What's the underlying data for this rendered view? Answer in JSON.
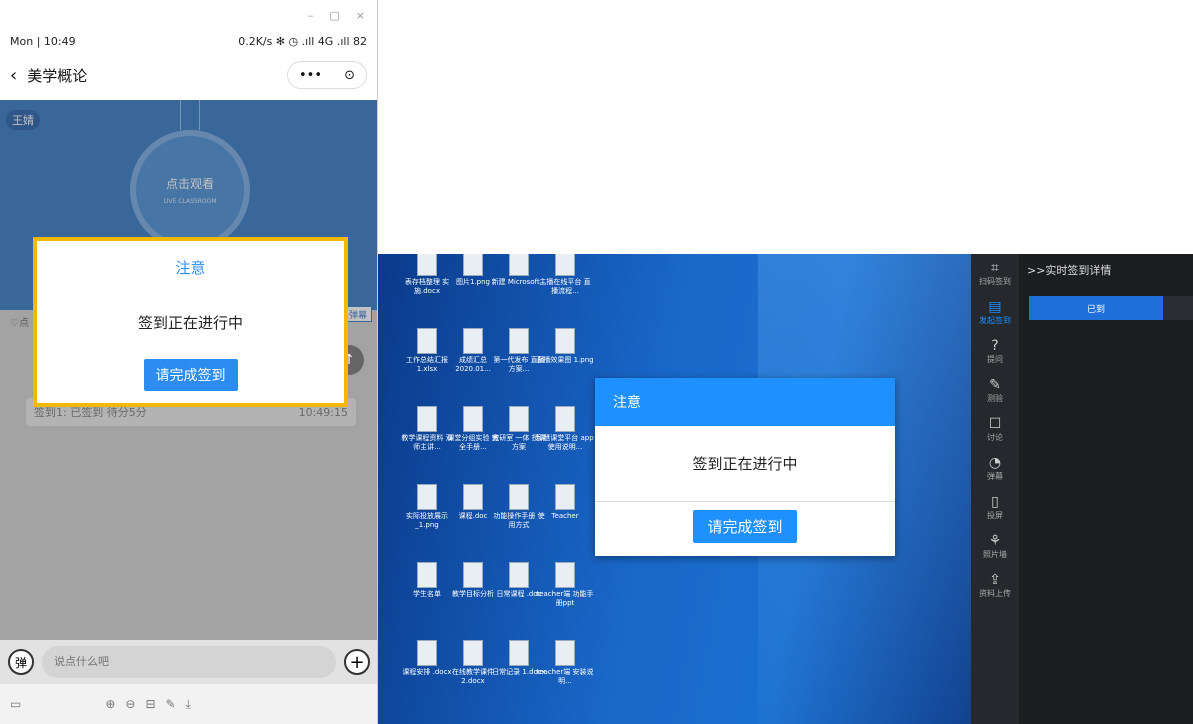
{
  "phone": {
    "window_controls": [
      "–",
      "▢",
      "×"
    ],
    "status_left": "Mon | 10:49",
    "status_right": "0.2K/s ✻ ◷ .ıll 4G .ıll 82",
    "nav_title": "美学概论",
    "capsule_more": "•••",
    "capsule_close": "⊙",
    "teacher": "王婧",
    "live_main": "点击观看",
    "live_sub": "LIVE CLASSROOM",
    "like": "♡点",
    "tag_btn": "弹幕",
    "sign_card_left": "签到1: 已签到 待分5分",
    "sign_card_right": "10:49:15",
    "modal": {
      "title": "注意",
      "body": "签到正在进行中",
      "button": "请完成签到"
    },
    "input_placeholder": "说点什么吧",
    "dan_label": "弹",
    "toolbar": [
      "⊕",
      "⊖",
      "⊟",
      "✎",
      "⤓"
    ]
  },
  "desktop": {
    "icons": [
      {
        "label": "表存档整理 实施.docx"
      },
      {
        "label": "图片1.png"
      },
      {
        "label": "新建 Microsoft..."
      },
      {
        "label": "主播在线平台 直播流程..."
      },
      {
        "label": "工作总结汇报 1.xlsx"
      },
      {
        "label": "成绩汇总 2020.01..."
      },
      {
        "label": "第一代发布 直播方案..."
      },
      {
        "label": "直播效果图 1.png"
      },
      {
        "label": "教学课程资料 双师主讲..."
      },
      {
        "label": "课堂分组实验 完全手册..."
      },
      {
        "label": "教研室 一体 授课方案"
      },
      {
        "label": "智慧课堂平台 app使用说明..."
      },
      {
        "label": "实际投放展示 _1.png"
      },
      {
        "label": "课程.doc"
      },
      {
        "label": "功能操作手册 使用方式"
      },
      {
        "label": "Teacher"
      },
      {
        "label": "学生名单"
      },
      {
        "label": "教学目标分析"
      },
      {
        "label": "日常课程 .doc"
      },
      {
        "label": "teacher端 功能手册ppt"
      },
      {
        "label": "课程安排 .docx"
      },
      {
        "label": "在线教学课件 2.docx"
      },
      {
        "label": "日常记录 1.docx"
      },
      {
        "label": "teacher端 安装说明..."
      }
    ],
    "modal": {
      "title": "注意",
      "body": "签到正在进行中",
      "button": "请完成签到"
    }
  },
  "rail": [
    {
      "icon": "⌗",
      "label": "扫码签到"
    },
    {
      "icon": "▤",
      "label": "发起签到",
      "active": true
    },
    {
      "icon": "?",
      "label": "提问"
    },
    {
      "icon": "✎",
      "label": "测验"
    },
    {
      "icon": "☐",
      "label": "讨论"
    },
    {
      "icon": "◔",
      "label": "弹幕"
    },
    {
      "icon": "▯",
      "label": "投屏"
    },
    {
      "icon": "⚘",
      "label": "照片墙"
    },
    {
      "icon": "⇪",
      "label": "资料上传"
    }
  ],
  "panel": {
    "title": ">>实时签到详情",
    "tab_active": "已到"
  },
  "colors": {
    "accent": "#1e90ff",
    "highlight_border": "#f5b800"
  }
}
